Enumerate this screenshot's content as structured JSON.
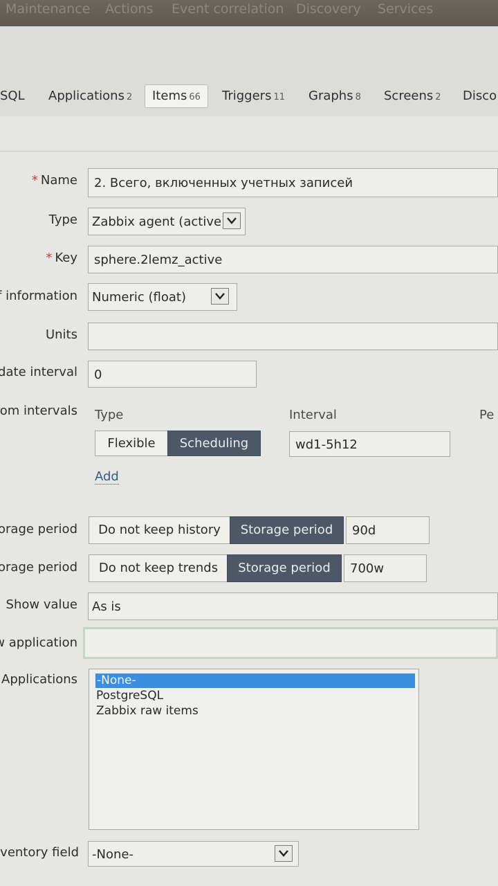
{
  "top_nav": {
    "items": [
      "Maintenance",
      "Actions",
      "Event correlation",
      "Discovery",
      "Services"
    ]
  },
  "tabs": {
    "items": [
      {
        "label": "SQL",
        "count": ""
      },
      {
        "label": "Applications",
        "count": "2"
      },
      {
        "label": "Items",
        "count": "66"
      },
      {
        "label": "Triggers",
        "count": "11"
      },
      {
        "label": "Graphs",
        "count": "8"
      },
      {
        "label": "Screens",
        "count": "2"
      },
      {
        "label": "Disco",
        "count": ""
      }
    ]
  },
  "form": {
    "name": {
      "label": "Name",
      "value": "2. Всего, включенных учетных записей"
    },
    "type": {
      "label": "Type",
      "value": "Zabbix agent (active)"
    },
    "key": {
      "label": "Key",
      "value": "sphere.2lemz_active"
    },
    "info_type": {
      "label": "of information",
      "value": "Numeric (float)"
    },
    "units": {
      "label": "Units",
      "value": ""
    },
    "update_interval": {
      "label": "odate interval",
      "value": "0"
    },
    "custom_intervals": {
      "label": "stom intervals",
      "col_type": "Type",
      "col_interval": "Interval",
      "col_period": "Pe",
      "flexible_label": "Flexible",
      "scheduling_label": "Scheduling",
      "interval_value": "wd1-5h12",
      "add_label": "Add"
    },
    "history": {
      "label": "torage period",
      "no_keep_label": "Do not keep history",
      "storage_label": "Storage period",
      "value": "90d"
    },
    "trends": {
      "label": "torage period",
      "no_keep_label": "Do not keep trends",
      "storage_label": "Storage period",
      "value": "700w"
    },
    "show_value": {
      "label": "Show value",
      "value": "As is"
    },
    "new_application": {
      "label": "w application",
      "value": ""
    },
    "applications": {
      "label": "Applications",
      "options": [
        "-None-",
        "PostgreSQL",
        "Zabbix raw items"
      ],
      "selected": "-None-"
    },
    "inventory_field": {
      "label": "nventory field",
      "value": "-None-"
    }
  },
  "colors": {
    "accent_dark_button": "#4d5866",
    "list_selection": "#3c8fe0",
    "required_mark": "#cc3b3b",
    "link": "#2f5d86"
  }
}
